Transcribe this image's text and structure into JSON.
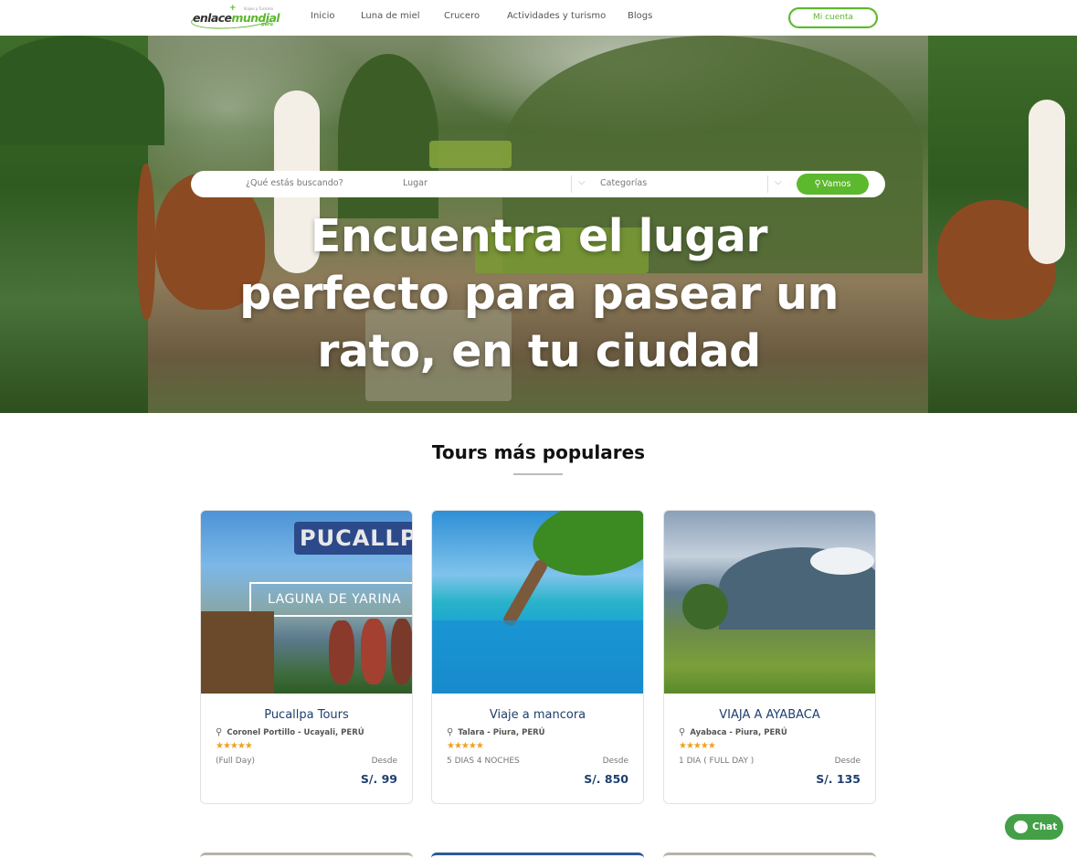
{
  "header": {
    "logo": {
      "main_1": "enlace",
      "main_2": "mundial",
      "tagline": "Viajes y Turismo",
      "sub": "perú"
    },
    "nav": [
      {
        "label": "Inicio"
      },
      {
        "label": "Luna de miel"
      },
      {
        "label": "Crucero"
      },
      {
        "label": "Actividades y turismo"
      },
      {
        "label": "Blogs"
      }
    ],
    "account_label": "Mi cuenta"
  },
  "hero": {
    "search": {
      "what_label": "¿Qué estás buscando?",
      "place_label": "Lugar",
      "category_label": "Categorías",
      "button_label": "Vamos"
    },
    "title": "Encuentra el lugar perfecto para pasear un rato, en tu ciudad"
  },
  "section": {
    "title": "Tours más populares"
  },
  "tours": [
    {
      "name": "Pucallpa Tours",
      "location": "Coronel Portillo - Ucayali, PERÚ",
      "stars": "★★★★★",
      "duration": "(Full Day)",
      "from_label": "Desde",
      "price": "S/. 99",
      "image_text_1": "PUCALLPA",
      "image_text_2": "LAGUNA DE YARINA"
    },
    {
      "name": "Viaje a mancora",
      "location": "Talara - Piura, PERÚ",
      "stars": "★★★★★",
      "duration": "5 DIAS 4 NOCHES",
      "from_label": "Desde",
      "price": "S/. 850"
    },
    {
      "name": "VIAJA A AYABACA",
      "location": "Ayabaca - Piura, PERÚ",
      "stars": "★★★★★",
      "duration": "1 DIA ( FULL DAY )",
      "from_label": "Desde",
      "price": "S/. 135"
    }
  ],
  "chat": {
    "label": "Chat"
  },
  "colors": {
    "brand_green": "#5cb82d",
    "title_blue": "#1f3f6e",
    "star": "#f0a01e",
    "chat_green": "#43a047"
  }
}
